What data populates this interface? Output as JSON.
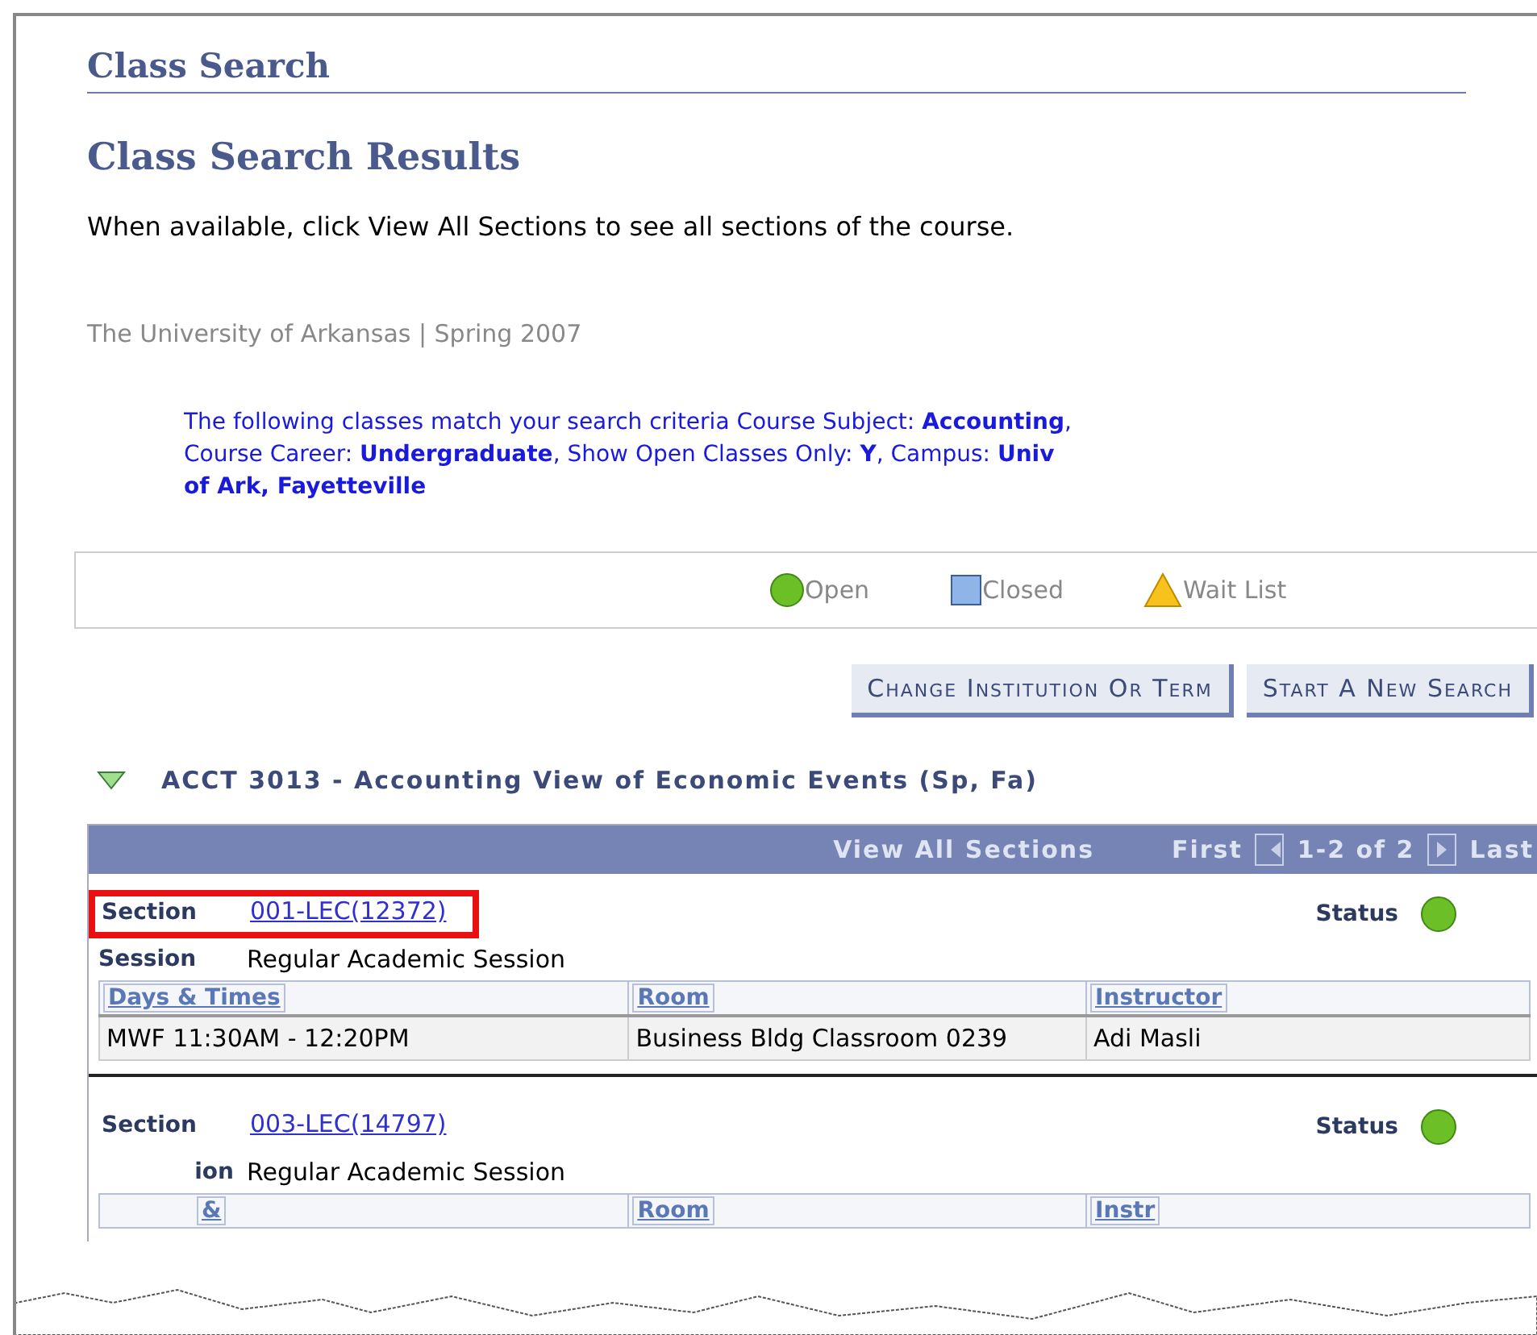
{
  "page_title": "Class Search",
  "results_title": "Class Search Results",
  "instructions": "When available, click View All Sections to see all sections of the course.",
  "institution_term": "The University of Arkansas | Spring 2007",
  "criteria": "The following classes match your search criteria Course Subject: **Accounting**,  Course Career: **Undergraduate**,  Show Open Classes Only: **Y**,  Campus: **Univ of Ark, Fayetteville**",
  "legend": [
    {
      "kind": "open",
      "label": "Open"
    },
    {
      "kind": "closed",
      "label": "Closed"
    },
    {
      "kind": "waitlist",
      "label": "Wait List"
    }
  ],
  "buttons": [
    "Change Institution Or Term",
    "Start A New Search"
  ],
  "course": {
    "title": "ACCT 3013 - Accounting View of Economic Events (Sp, Fa)",
    "expanded": true,
    "grid_header": {
      "view_all": "View All Sections",
      "first": "First",
      "range": "1-2 of 2",
      "last": "Last"
    },
    "sections": [
      {
        "section_label": "Section",
        "section": "001-LEC(12372)",
        "highlighted": true,
        "status_label": "Status",
        "open": true,
        "session_label": "Session",
        "session": "Regular Academic Session",
        "columns": [
          "Days & Times",
          "Room",
          "Instructor"
        ],
        "rows": [
          [
            "MWF 11:30AM - 12:20PM",
            "Business Bldg Classroom 0239",
            "Adi Masli"
          ]
        ]
      },
      {
        "section_label": "Section",
        "section": "003-LEC(14797)",
        "highlighted": false,
        "status_label": "Status",
        "open": true,
        "session_label": "ion",
        "session": "Regular Academic Session",
        "columns": [
          "&",
          "Room",
          "Instr"
        ]
      }
    ]
  }
}
